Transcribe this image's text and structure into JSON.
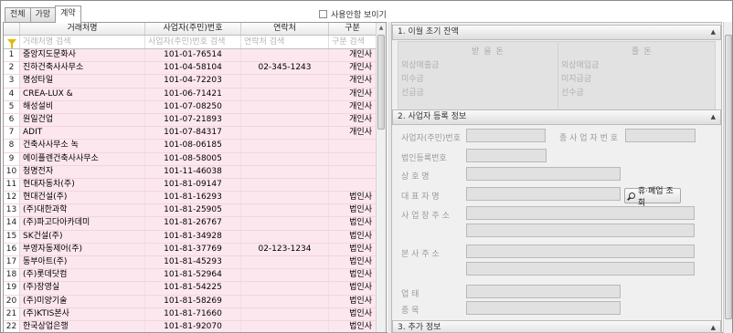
{
  "tabs": [
    "전체",
    "가망",
    "계약"
  ],
  "show_unused_label": "사용안함 보이기",
  "grid": {
    "columns": [
      "거래처명",
      "사업자(주민)번호",
      "연락처",
      "구분"
    ],
    "filters": [
      "거래처명 검색",
      "사업자(주민)번호 검색",
      "연락처 검색",
      "구분 검색"
    ],
    "rows": [
      {
        "no": "1",
        "name": "중앙지도문화사",
        "biz": "101-01-76514",
        "tel": "",
        "type": "개인사"
      },
      {
        "no": "2",
        "name": "진하건축사사무소",
        "biz": "101-04-58104",
        "tel": "02-345-1243",
        "type": "개인사"
      },
      {
        "no": "3",
        "name": "명성타일",
        "biz": "101-04-72203",
        "tel": "",
        "type": "개인사"
      },
      {
        "no": "4",
        "name": "CREA-LUX &",
        "biz": "101-06-71421",
        "tel": "",
        "type": "개인사"
      },
      {
        "no": "5",
        "name": "해성설비",
        "biz": "101-07-08250",
        "tel": "",
        "type": "개인사"
      },
      {
        "no": "6",
        "name": "원일건업",
        "biz": "101-07-21893",
        "tel": "",
        "type": "개인사"
      },
      {
        "no": "7",
        "name": "ADIT",
        "biz": "101-07-84317",
        "tel": "",
        "type": "개인사"
      },
      {
        "no": "8",
        "name": "건축사사무소 녹",
        "biz": "101-08-06185",
        "tel": "",
        "type": ""
      },
      {
        "no": "9",
        "name": "에이플렌건축사사무소",
        "biz": "101-08-58005",
        "tel": "",
        "type": ""
      },
      {
        "no": "10",
        "name": "청명전자",
        "biz": "101-11-46038",
        "tel": "",
        "type": ""
      },
      {
        "no": "11",
        "name": "현대자동차(주)",
        "biz": "101-81-09147",
        "tel": "",
        "type": ""
      },
      {
        "no": "12",
        "name": "현대건설(주)",
        "biz": "101-81-16293",
        "tel": "",
        "type": "법인사"
      },
      {
        "no": "13",
        "name": "(주)대한과학",
        "biz": "101-81-25905",
        "tel": "",
        "type": "법인사"
      },
      {
        "no": "14",
        "name": "(주)파고다아카데미",
        "biz": "101-81-26767",
        "tel": "",
        "type": "법인사"
      },
      {
        "no": "15",
        "name": "SK건설(주)",
        "biz": "101-81-34928",
        "tel": "",
        "type": "법인사"
      },
      {
        "no": "16",
        "name": "부영자동제어(주)",
        "biz": "101-81-37769",
        "tel": "02-123-1234",
        "type": "법인사"
      },
      {
        "no": "17",
        "name": "동부아트(주)",
        "biz": "101-81-45293",
        "tel": "",
        "type": "법인사"
      },
      {
        "no": "18",
        "name": "(주)롯데닷컴",
        "biz": "101-81-52964",
        "tel": "",
        "type": "법인사"
      },
      {
        "no": "19",
        "name": "(주)장영실",
        "biz": "101-81-54225",
        "tel": "",
        "type": "법인사"
      },
      {
        "no": "20",
        "name": "(주)미양기술",
        "biz": "101-81-58269",
        "tel": "",
        "type": "법인사"
      },
      {
        "no": "21",
        "name": "(주)KTIS본사",
        "biz": "101-81-71660",
        "tel": "",
        "type": "법인사"
      },
      {
        "no": "22",
        "name": "한국상업은행",
        "biz": "101-81-92070",
        "tel": "",
        "type": "법인사"
      }
    ]
  },
  "section1": {
    "title": "1. 이월 초기 잔액",
    "receivable_header": "받을돈",
    "payable_header": "줄돈",
    "left_labels": [
      "외상매출금",
      "미수금",
      "선급금"
    ],
    "right_labels": [
      "외상매입금",
      "미지급금",
      "선수금"
    ]
  },
  "section2": {
    "title": "2. 사업자 등록 정보",
    "labels": {
      "biz_no": "사업자(주민)번호",
      "sub_biz_no": "종 사 업 자 번 호",
      "corp_no": "법인등록번호",
      "company_name": "상 호 명",
      "ceo": "대 표 자 명",
      "biz_address": "사 업 장 주 소",
      "hq_address": "본 사 주 소",
      "biz_type": "업 태",
      "biz_item": "종 목"
    },
    "lookup_button": "휴·폐업 조회"
  },
  "section3": {
    "title": "3. 추가 정보"
  }
}
